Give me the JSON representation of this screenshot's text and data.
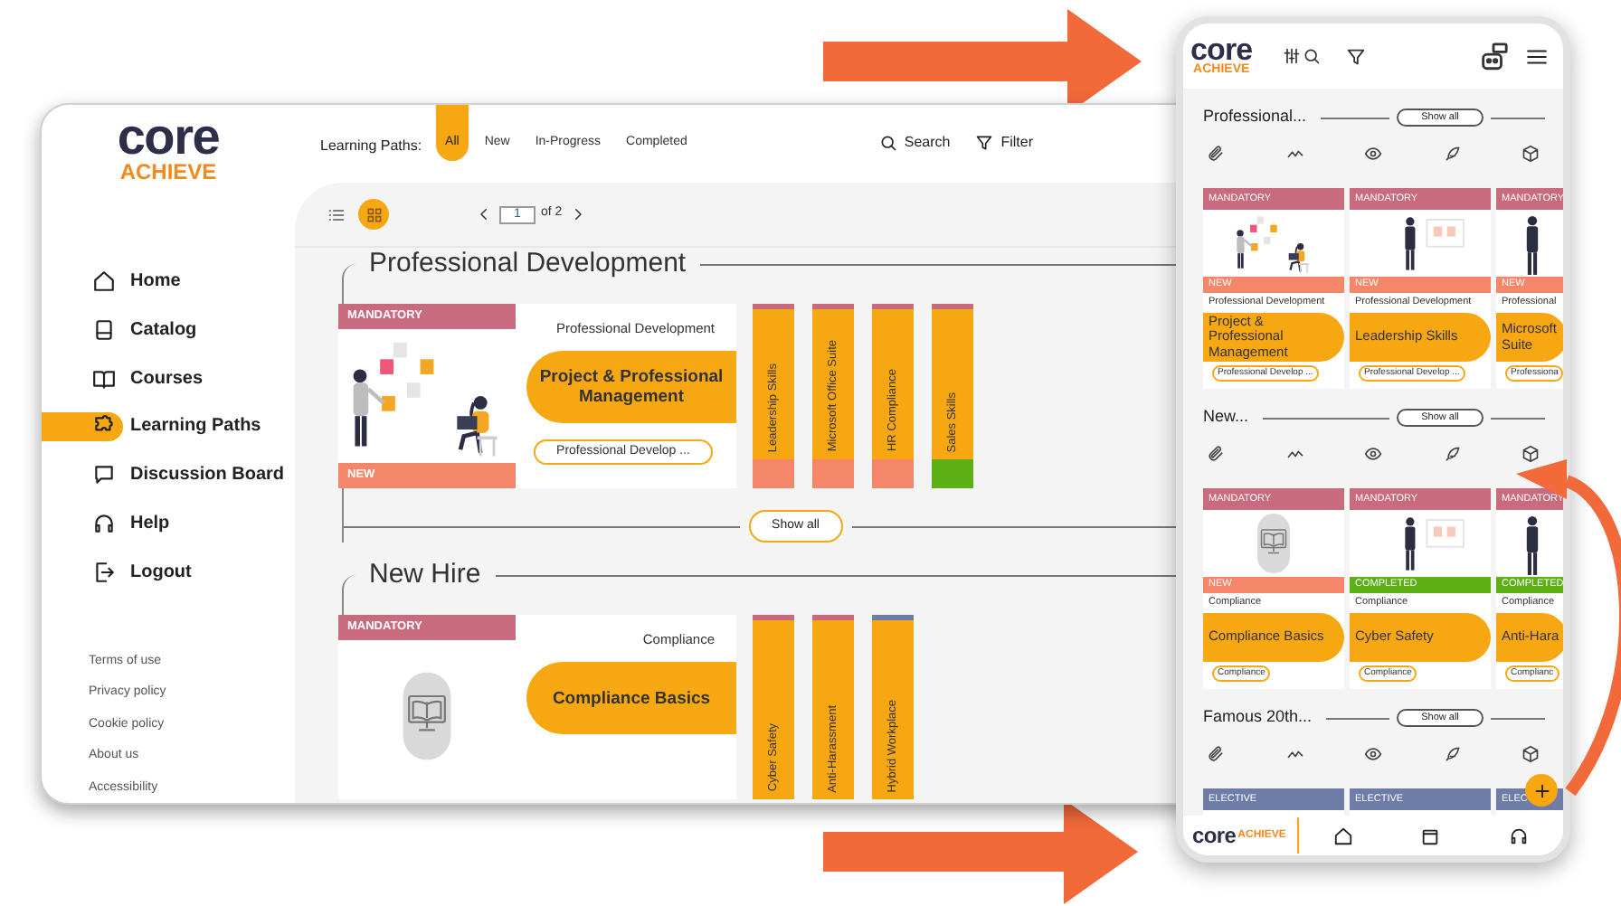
{
  "desktop": {
    "logo": {
      "word": "core",
      "tagline": "ACHIEVE"
    },
    "nav": [
      {
        "label": "Home",
        "selected": false
      },
      {
        "label": "Catalog",
        "selected": false
      },
      {
        "label": "Courses",
        "selected": false
      },
      {
        "label": "Learning Paths",
        "selected": true
      },
      {
        "label": "Discussion Board",
        "selected": false
      },
      {
        "label": "Help",
        "selected": false
      },
      {
        "label": "Logout",
        "selected": false
      }
    ],
    "footer_links": [
      "Terms of use",
      "Privacy policy",
      "Cookie policy",
      "About us",
      "Accessibility"
    ],
    "filter_label": "Learning Paths:",
    "filters": [
      {
        "label": "All",
        "selected": true
      },
      {
        "label": "New",
        "selected": false
      },
      {
        "label": "In-Progress",
        "selected": false
      },
      {
        "label": "Completed",
        "selected": false
      }
    ],
    "search": "Search",
    "filter": "Filter",
    "views": [
      {
        "selected": false
      },
      {
        "selected": true
      }
    ],
    "pager": {
      "page": "1",
      "of": "of 2"
    },
    "sections": [
      {
        "title": "Professional Development",
        "featured": {
          "banner": {
            "label": "MANDATORY",
            "color": "#c96b7f"
          },
          "status": {
            "label": "NEW",
            "color": "#f4876a"
          },
          "category": "Professional Development",
          "title": "Project & Professional Management",
          "tag": "Professional Develop ..."
        },
        "strips": [
          {
            "label": "Leadership Skills",
            "color": "#c96b7f",
            "status": {
              "color": "#f4876a"
            }
          },
          {
            "label": "Microsoft Office Suite",
            "color": "#c96b7f",
            "status": {
              "color": "#f4876a"
            }
          },
          {
            "label": "HR Compliance",
            "color": "#c96b7f",
            "status": {
              "color": "#f4876a"
            }
          },
          {
            "label": "Sales Skills",
            "color": "#c96b7f",
            "status": {
              "color": "#5daf16"
            }
          }
        ],
        "show_all": "Show all"
      },
      {
        "title": "New Hire",
        "featured": {
          "banner": {
            "label": "MANDATORY",
            "color": "#c96b7f"
          },
          "category": "Compliance",
          "title": "Compliance Basics"
        },
        "strips": [
          {
            "label": "Cyber Safety",
            "color": "#c96b7f"
          },
          {
            "label": "Anti-Harassment",
            "color": "#c96b7f"
          },
          {
            "label": "Hybrid Workplace",
            "color": "#6e7ca8"
          }
        ]
      }
    ]
  },
  "mobile": {
    "logo": {
      "word": "core",
      "tagline": "ACHIEVE"
    },
    "sections": [
      {
        "title": "Professional...",
        "show_all": "Show all",
        "cards": [
          {
            "banner": {
              "label": "MANDATORY",
              "color": "#c96b7f"
            },
            "status": {
              "label": "NEW",
              "color": "#f4876a"
            },
            "category": "Professional Development",
            "title": "Project & Professional Management",
            "tag": "Professional Develop ..."
          },
          {
            "banner": {
              "label": "MANDATORY",
              "color": "#c96b7f"
            },
            "status": {
              "label": "NEW",
              "color": "#f4876a"
            },
            "category": "Professional Development",
            "title": "Leadership Skills",
            "tag": "Professional Develop ..."
          },
          {
            "banner": {
              "label": "MANDATORY",
              "color": "#c96b7f"
            },
            "status": {
              "label": "NEW",
              "color": "#f4876a"
            },
            "category": "Professional",
            "title": "Microsoft Suite",
            "tag": "Professiona"
          }
        ]
      },
      {
        "title": "New...",
        "show_all": "Show all",
        "cards": [
          {
            "banner": {
              "label": "MANDATORY",
              "color": "#c96b7f"
            },
            "status": {
              "label": "NEW",
              "color": "#f4876a"
            },
            "category": "Compliance",
            "title": "Compliance Basics",
            "tag": "Compliance"
          },
          {
            "banner": {
              "label": "MANDATORY",
              "color": "#c96b7f"
            },
            "status": {
              "label": "COMPLETED",
              "color": "#5daf16"
            },
            "category": "Compliance",
            "title": "Cyber Safety",
            "tag": "Compliance"
          },
          {
            "banner": {
              "label": "MANDATORY",
              "color": "#c96b7f"
            },
            "status": {
              "label": "COMPLETED",
              "color": "#5daf16"
            },
            "category": "Compliance",
            "title": "Anti-Hara",
            "tag": "Complianc"
          }
        ]
      },
      {
        "title": "Famous 20th...",
        "show_all": "Show all",
        "cards": [
          {
            "banner": {
              "label": "ELECTIVE",
              "color": "#6e7ca8"
            }
          },
          {
            "banner": {
              "label": "ELECTIVE",
              "color": "#6e7ca8"
            }
          },
          {
            "banner": {
              "label": "ELEC",
              "color": "#6e7ca8"
            }
          }
        ]
      }
    ],
    "nav_logo": {
      "word": "core",
      "tagline": "ACHIEVE"
    }
  }
}
